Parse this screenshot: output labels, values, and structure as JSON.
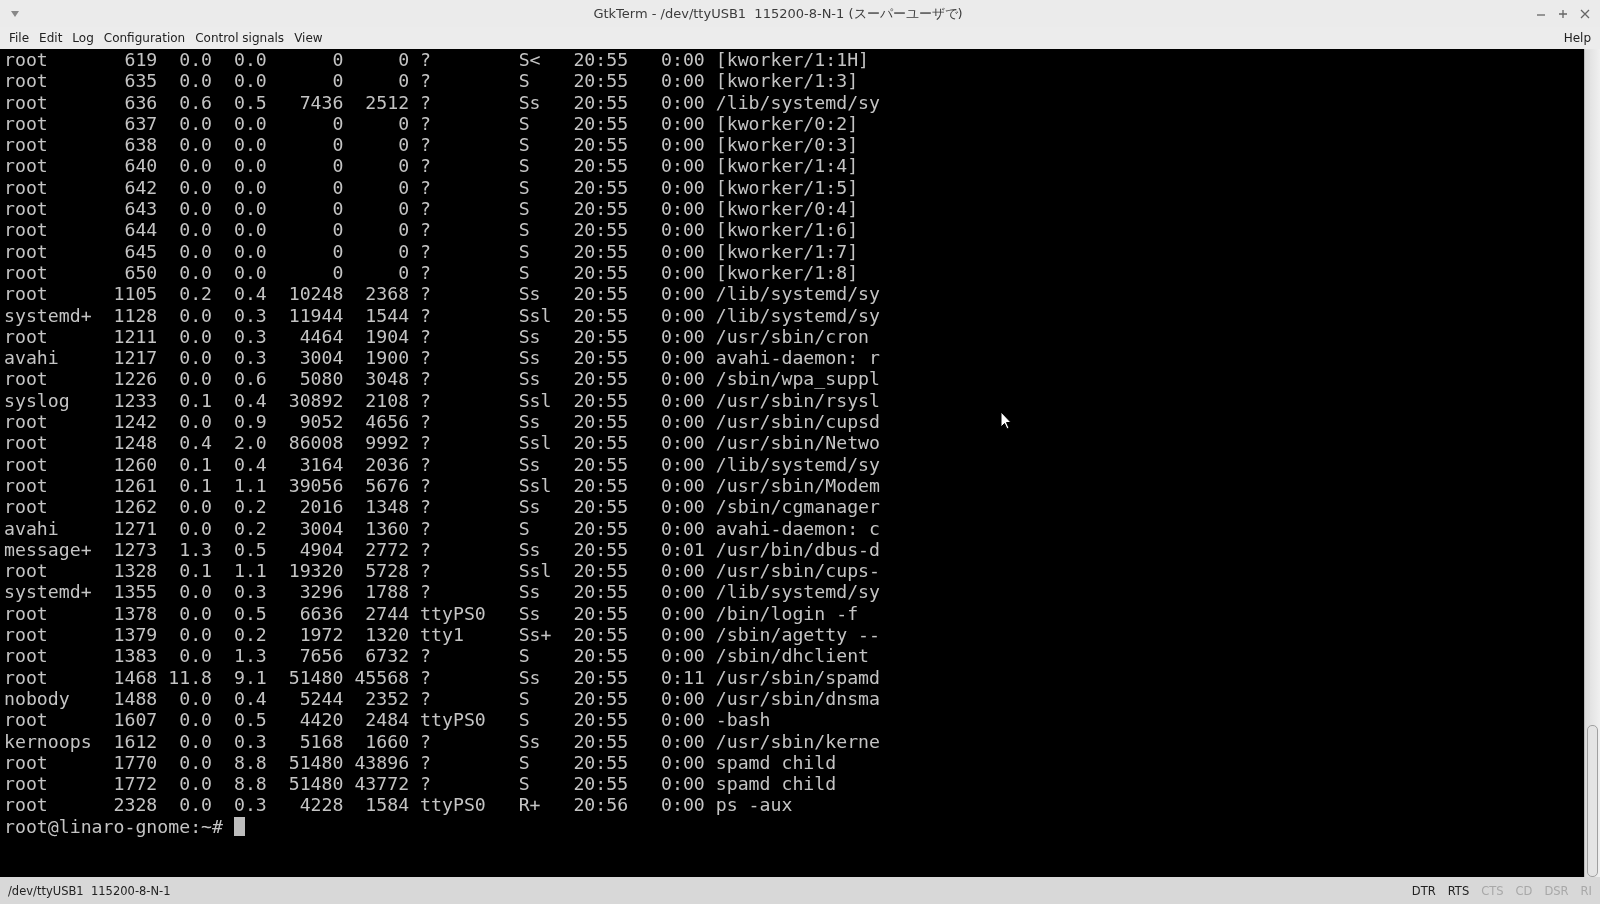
{
  "window": {
    "title": "GtkTerm - /dev/ttyUSB1  115200-8-N-1 (スーパーユーザで)"
  },
  "menu": {
    "items": [
      "File",
      "Edit",
      "Log",
      "Configuration",
      "Control signals",
      "View"
    ],
    "right": "Help"
  },
  "terminal": {
    "lines": [
      "root       619  0.0  0.0      0     0 ?        S<   20:55   0:00 [kworker/1:1H]",
      "root       635  0.0  0.0      0     0 ?        S    20:55   0:00 [kworker/1:3]",
      "root       636  0.6  0.5   7436  2512 ?        Ss   20:55   0:00 /lib/systemd/sy",
      "root       637  0.0  0.0      0     0 ?        S    20:55   0:00 [kworker/0:2]",
      "root       638  0.0  0.0      0     0 ?        S    20:55   0:00 [kworker/0:3]",
      "root       640  0.0  0.0      0     0 ?        S    20:55   0:00 [kworker/1:4]",
      "root       642  0.0  0.0      0     0 ?        S    20:55   0:00 [kworker/1:5]",
      "root       643  0.0  0.0      0     0 ?        S    20:55   0:00 [kworker/0:4]",
      "root       644  0.0  0.0      0     0 ?        S    20:55   0:00 [kworker/1:6]",
      "root       645  0.0  0.0      0     0 ?        S    20:55   0:00 [kworker/1:7]",
      "root       650  0.0  0.0      0     0 ?        S    20:55   0:00 [kworker/1:8]",
      "root      1105  0.2  0.4  10248  2368 ?        Ss   20:55   0:00 /lib/systemd/sy",
      "systemd+  1128  0.0  0.3  11944  1544 ?        Ssl  20:55   0:00 /lib/systemd/sy",
      "root      1211  0.0  0.3   4464  1904 ?        Ss   20:55   0:00 /usr/sbin/cron",
      "avahi     1217  0.0  0.3   3004  1900 ?        Ss   20:55   0:00 avahi-daemon: r",
      "root      1226  0.0  0.6   5080  3048 ?        Ss   20:55   0:00 /sbin/wpa_suppl",
      "syslog    1233  0.1  0.4  30892  2108 ?        Ssl  20:55   0:00 /usr/sbin/rsysl",
      "root      1242  0.0  0.9   9052  4656 ?        Ss   20:55   0:00 /usr/sbin/cupsd",
      "root      1248  0.4  2.0  86008  9992 ?        Ssl  20:55   0:00 /usr/sbin/Netwo",
      "root      1260  0.1  0.4   3164  2036 ?        Ss   20:55   0:00 /lib/systemd/sy",
      "root      1261  0.1  1.1  39056  5676 ?        Ssl  20:55   0:00 /usr/sbin/Modem",
      "root      1262  0.0  0.2   2016  1348 ?        Ss   20:55   0:00 /sbin/cgmanager",
      "avahi     1271  0.0  0.2   3004  1360 ?        S    20:55   0:00 avahi-daemon: c",
      "message+  1273  1.3  0.5   4904  2772 ?        Ss   20:55   0:01 /usr/bin/dbus-d",
      "root      1328  0.1  1.1  19320  5728 ?        Ssl  20:55   0:00 /usr/sbin/cups-",
      "systemd+  1355  0.0  0.3   3296  1788 ?        Ss   20:55   0:00 /lib/systemd/sy",
      "root      1378  0.0  0.5   6636  2744 ttyPS0   Ss   20:55   0:00 /bin/login -f",
      "root      1379  0.0  0.2   1972  1320 tty1     Ss+  20:55   0:00 /sbin/agetty --",
      "root      1383  0.0  1.3   7656  6732 ?        S    20:55   0:00 /sbin/dhclient",
      "root      1468 11.8  9.1  51480 45568 ?        Ss   20:55   0:11 /usr/sbin/spamd",
      "nobody    1488  0.0  0.4   5244  2352 ?        S    20:55   0:00 /usr/sbin/dnsma",
      "root      1607  0.0  0.5   4420  2484 ttyPS0   S    20:55   0:00 -bash",
      "kernoops  1612  0.0  0.3   5168  1660 ?        Ss   20:55   0:00 /usr/sbin/kerne",
      "root      1770  0.0  8.8  51480 43896 ?        S    20:55   0:00 spamd child",
      "root      1772  0.0  8.8  51480 43772 ?        S    20:55   0:00 spamd child",
      "root      2328  0.0  0.3   4228  1584 ttyPS0   R+   20:56   0:00 ps -aux"
    ],
    "prompt": "root@linaro-gnome:~#"
  },
  "status_bar": {
    "port": "/dev/ttyUSB1  115200-8-N-1",
    "signals": [
      {
        "label": "DTR",
        "on": true
      },
      {
        "label": "RTS",
        "on": true
      },
      {
        "label": "CTS",
        "on": false
      },
      {
        "label": "CD",
        "on": false
      },
      {
        "label": "DSR",
        "on": false
      },
      {
        "label": "RI",
        "on": false
      }
    ]
  }
}
